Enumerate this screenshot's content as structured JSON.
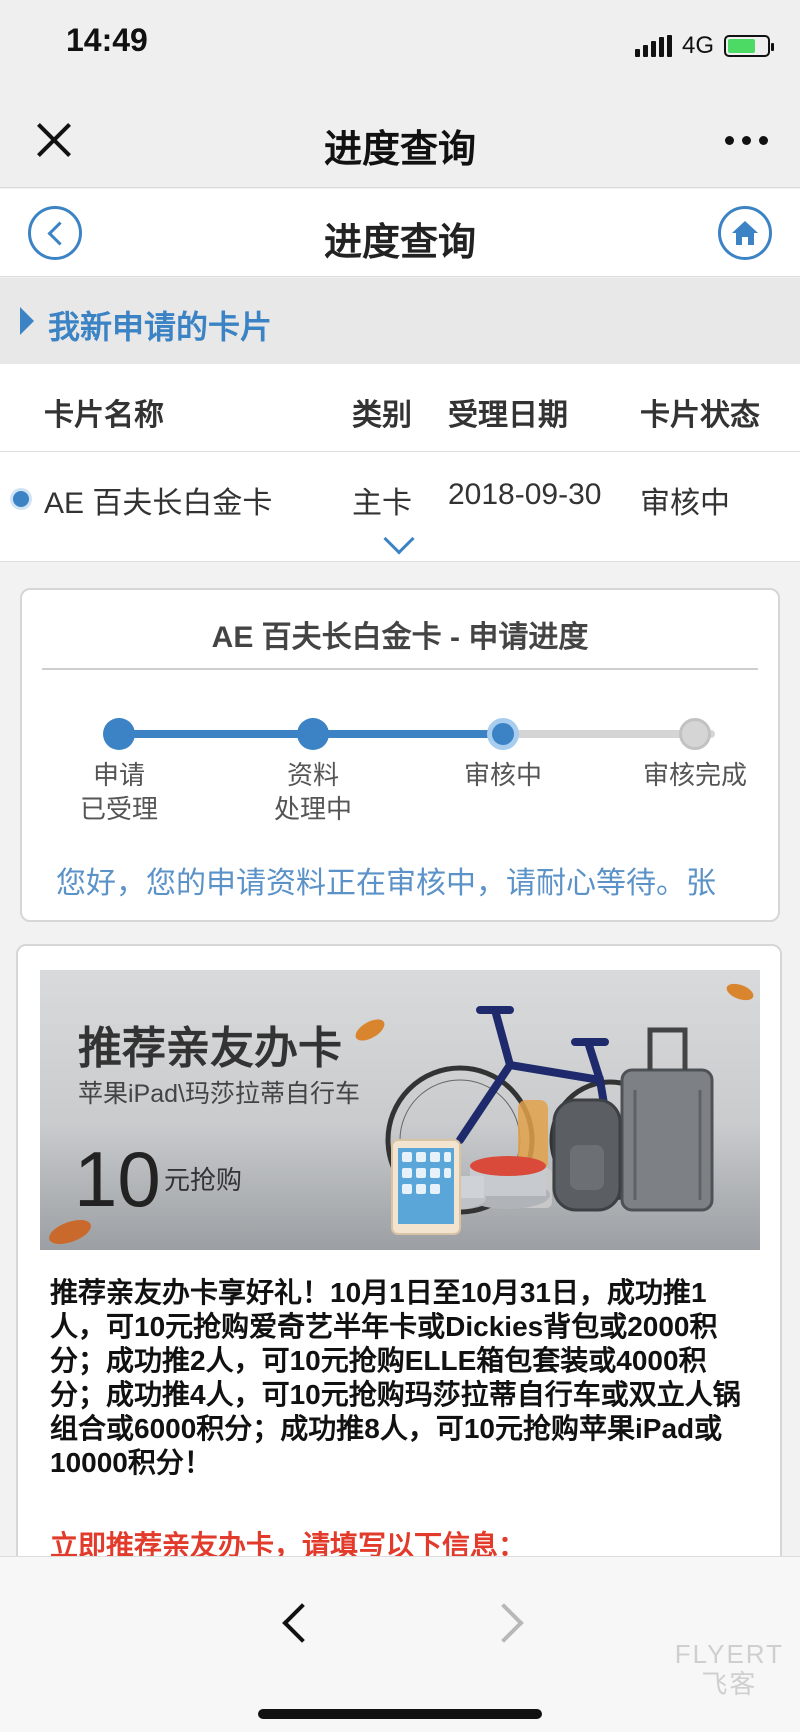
{
  "status_bar": {
    "time": "14:49",
    "network": "4G"
  },
  "wechat_nav": {
    "title": "进度查询"
  },
  "header": {
    "title": "进度查询"
  },
  "section": {
    "label": "我新申请的卡片"
  },
  "table": {
    "headers": [
      "卡片名称",
      "类别",
      "受理日期",
      "卡片状态"
    ],
    "rows": [
      {
        "name": "AE 百夫长白金卡",
        "type": "主卡",
        "date": "2018-09-30",
        "status": "审核中"
      }
    ]
  },
  "progress": {
    "title": "AE 百夫长白金卡 - 申请进度",
    "steps": [
      {
        "label": "申请\n已受理",
        "state": "done"
      },
      {
        "label": "资料\n处理中",
        "state": "done"
      },
      {
        "label": "审核中",
        "state": "current"
      },
      {
        "label": "审核完成",
        "state": "todo"
      }
    ],
    "message": "您好，您的申请资料正在审核中，请耐心等待。张"
  },
  "promo": {
    "banner_title": "推荐亲友办卡",
    "banner_subtitle": "苹果iPad\\玛莎拉蒂自行车",
    "banner_price": "10",
    "banner_price_unit": "元抢购",
    "description": "推荐亲友办卡享好礼！10月1日至10月31日，成功推1人，可10元抢购爱奇艺半年卡或Dickies背包或2000积分；成功推2人，可10元抢购ELLE箱包套装或4000积分；成功推4人，可10元抢购玛莎拉蒂自行车或双立人锅组合或6000积分；成功推8人，可10元抢购苹果iPad或10000积分！",
    "cta": "立即推荐亲友办卡，请填写以下信息："
  },
  "watermark": {
    "line1": "FLYERT",
    "line2": "飞客"
  },
  "colors": {
    "accent": "#3b83c4",
    "cta_red": "#e23a2b",
    "track_gray": "#d5d5d5"
  }
}
